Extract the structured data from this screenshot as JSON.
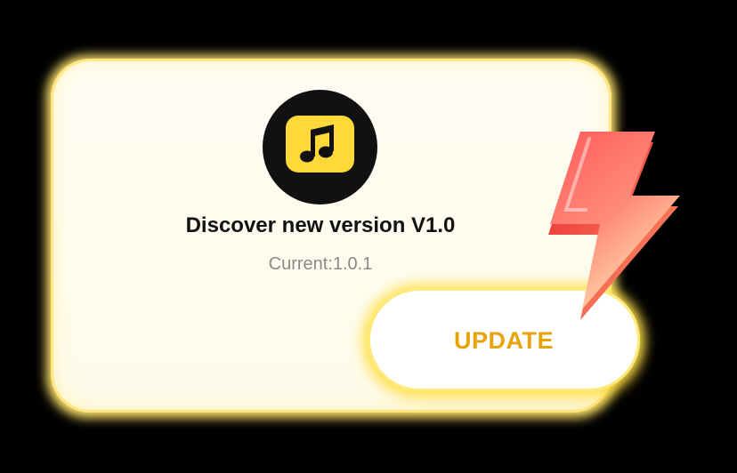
{
  "dialog": {
    "title": "Discover new version V1.0",
    "current_version": "Current:1.0.1",
    "update_label": "UPDATE"
  },
  "icons": {
    "app_icon": "music-note-icon",
    "decoration": "lightning-bolt-icon"
  },
  "colors": {
    "accent": "#ffd93a",
    "update_text": "#e8a20a",
    "bolt_red": "#ff4b4b",
    "card_background": "#fffdf3"
  }
}
